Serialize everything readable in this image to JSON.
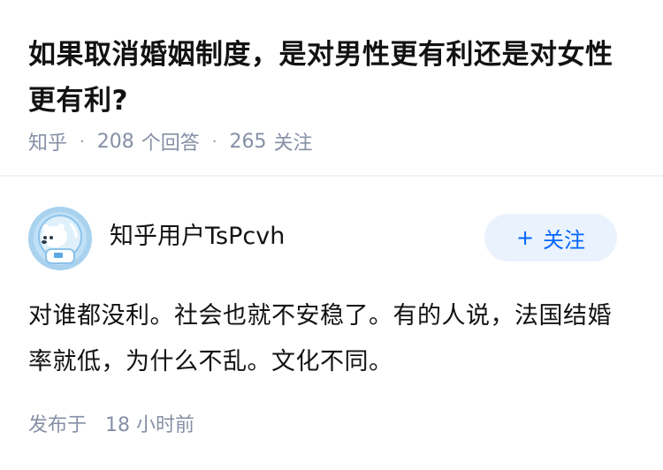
{
  "question": {
    "title": "如果取消婚姻制度，是对男性更有利还是对女性更有利?",
    "source": "知乎",
    "answer_count": "208",
    "answer_label": "个回答",
    "follower_count": "265",
    "follower_label": "关注"
  },
  "answer": {
    "author": {
      "name": "知乎用户TsPcvh",
      "avatar_icon": "polar-bear-avatar"
    },
    "follow_button": {
      "icon": "+",
      "label": "关注"
    },
    "body": "对谁都没利。社会也就不安稳了。有的人说，法国结婚率就低，为什么不乱。文化不同。",
    "posted_label": "发布于",
    "posted_time": "18 小时前"
  },
  "colors": {
    "accent": "#0066ff",
    "follow_bg": "#eaf2fd",
    "meta_text": "#8590a6"
  }
}
